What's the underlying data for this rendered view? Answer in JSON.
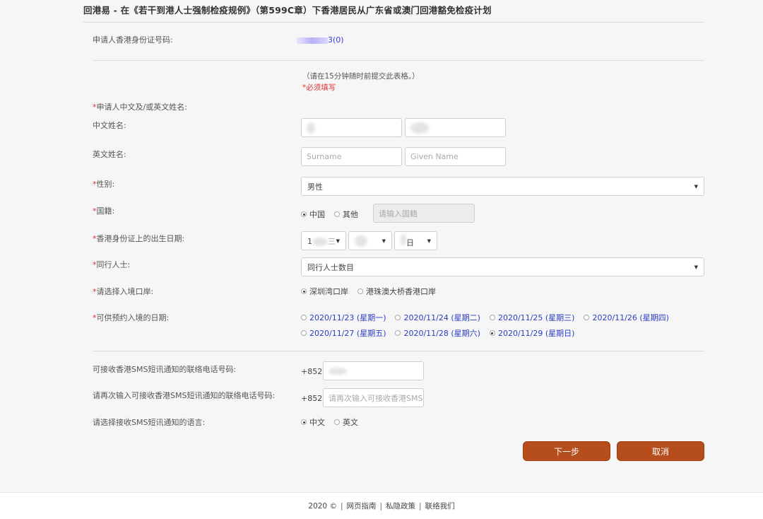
{
  "page_title": "回港易 - 在《若干到港人士强制检疫规例》（第599C章）下香港居民从广东省或澳门回港豁免检疫计划",
  "applicant_id": {
    "label": "申请人香港身份证号码:",
    "value_suffix": "3(0)"
  },
  "notice": {
    "submit_hint": "（请在15分钟随时前提交此表格。）",
    "required_hint": "*必须填写"
  },
  "name_section": {
    "label": "申请人中文及/或英文姓名:",
    "chinese_label": "中文姓名:",
    "english_label": "英文姓名:",
    "surname_placeholder": "Surname",
    "given_name_placeholder": "Given Name"
  },
  "gender": {
    "label": "性别:",
    "selected": "男性"
  },
  "nationality": {
    "label": "国籍:",
    "options": [
      "中国",
      "其他"
    ],
    "selected_index": 0,
    "other_placeholder": "请输入国籍"
  },
  "dob": {
    "label": "香港身份证上的出生日期:",
    "year_visible": "1",
    "year_suffix": "三",
    "day_suffix": "日"
  },
  "companions": {
    "label": "同行人士:",
    "selected": "同行人士数目"
  },
  "entry_port": {
    "label": "请选择入境口岸:",
    "options": [
      "深圳湾口岸",
      "港珠澳大桥香港口岸"
    ],
    "selected_index": 0
  },
  "entry_date": {
    "label": "可供预约入境的日期:",
    "options": [
      "2020/11/23 (星期一)",
      "2020/11/24 (星期二)",
      "2020/11/25 (星期三)",
      "2020/11/26 (星期四)",
      "2020/11/27 (星期五)",
      "2020/11/28 (星期六)",
      "2020/11/29 (星期日)"
    ],
    "selected_index": 6
  },
  "phone": {
    "label": "可接收香港SMS短讯通知的联络电话号码:",
    "prefix": "+852",
    "confirm_label": "请再次输入可接收香港SMS短讯通知的联络电话号码:",
    "confirm_prefix": "+852",
    "confirm_placeholder": "请再次输入可接收香港SMS"
  },
  "sms_language": {
    "label": "请选择接收SMS短讯通知的语言:",
    "options": [
      "中文",
      "英文"
    ],
    "selected_index": 0
  },
  "buttons": {
    "next": "下一步",
    "cancel": "取消"
  },
  "footer": {
    "copyright": "2020 ©",
    "links": [
      "网页指南",
      "私隐政策",
      "联络我们"
    ]
  },
  "colors": {
    "button": "#b54d1c",
    "date_link": "#2a3cc4",
    "required": "#d33333"
  }
}
